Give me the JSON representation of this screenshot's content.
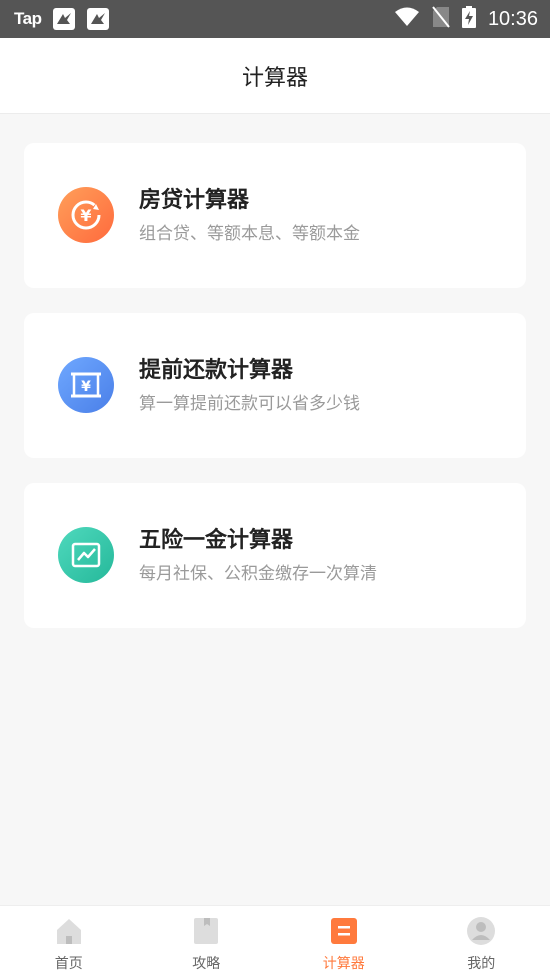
{
  "status_bar": {
    "carrier_logo": "Tap",
    "time": "10:36"
  },
  "header": {
    "title": "计算器"
  },
  "cards": [
    {
      "title": "房贷计算器",
      "subtitle": "组合贷、等额本息、等额本金",
      "icon": "yuan-refresh-icon",
      "color_from": "#ff9f5a",
      "color_to": "#ff6a3d"
    },
    {
      "title": "提前还款计算器",
      "subtitle": "算一算提前还款可以省多少钱",
      "icon": "yuan-scroll-icon",
      "color_from": "#6fa8ff",
      "color_to": "#4a7fe8"
    },
    {
      "title": "五险一金计算器",
      "subtitle": "每月社保、公积金缴存一次算清",
      "icon": "trend-chart-icon",
      "color_from": "#4fd9bd",
      "color_to": "#25b89a"
    }
  ],
  "bottom_nav": {
    "items": [
      {
        "label": "首页",
        "icon": "home-icon",
        "active": false
      },
      {
        "label": "攻略",
        "icon": "bookmark-icon",
        "active": false
      },
      {
        "label": "计算器",
        "icon": "calculator-icon",
        "active": true
      },
      {
        "label": "我的",
        "icon": "profile-icon",
        "active": false
      }
    ],
    "active_color": "#ff7a3d"
  }
}
